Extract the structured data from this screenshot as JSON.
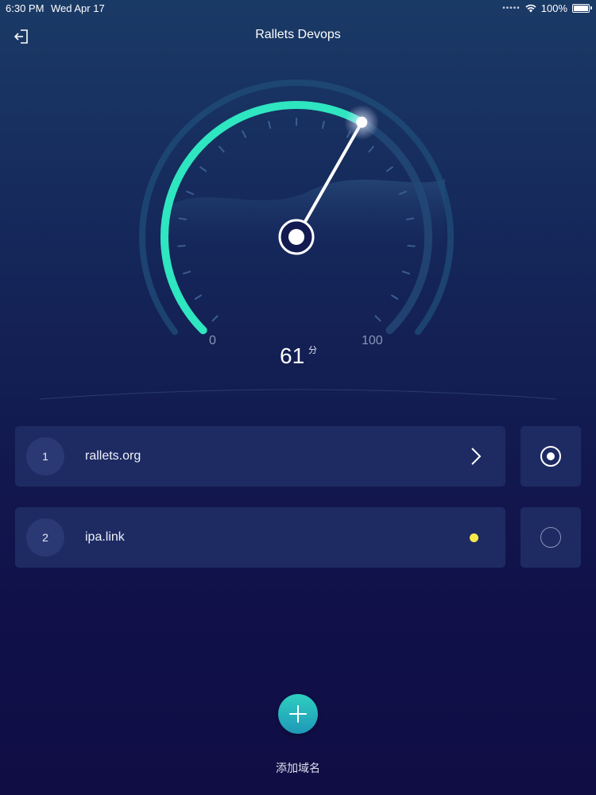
{
  "status_bar": {
    "time": "6:30 PM",
    "date": "Wed Apr 17",
    "battery": "100%",
    "icons": [
      "signal-dots-icon",
      "wifi-icon",
      "battery-icon"
    ]
  },
  "header": {
    "title": "Rallets Devops",
    "back_icon": "exit-icon"
  },
  "gauge": {
    "score": "61",
    "unit": "分",
    "min_label": "0",
    "max_label": "100",
    "score_value": 61,
    "accent_color": "#2ee6c0"
  },
  "domains": [
    {
      "index": "1",
      "name": "rallets.org",
      "trailing": "chevron-right-icon",
      "selected": true
    },
    {
      "index": "2",
      "name": "ipa.link",
      "trailing": "status-dot",
      "status_color": "#f7e84a",
      "selected": false
    }
  ],
  "add_domain": {
    "label": "添加域名",
    "icon": "plus-icon"
  }
}
